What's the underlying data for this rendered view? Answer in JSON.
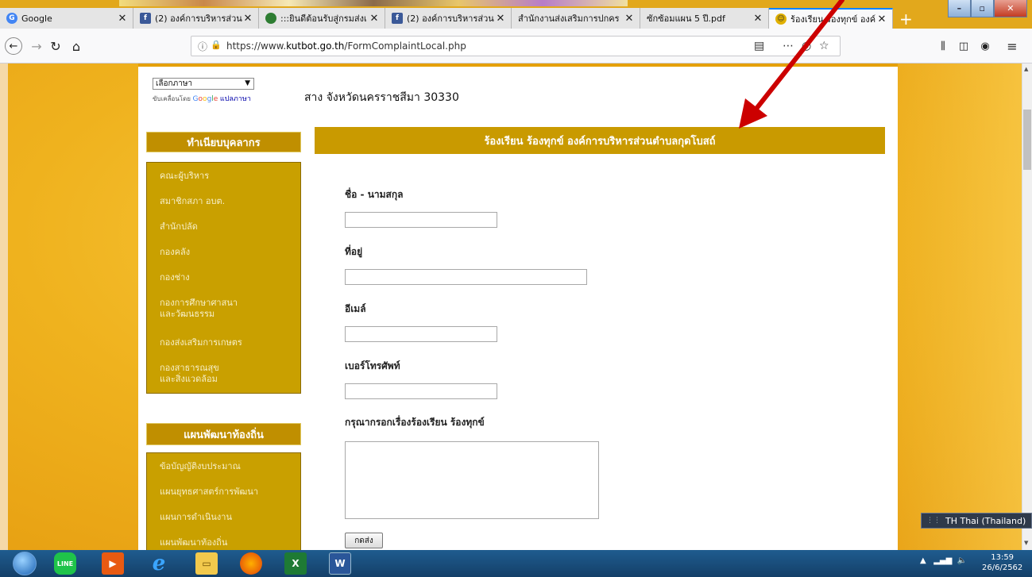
{
  "browser": {
    "tabs": [
      {
        "label": "Google",
        "icon": "google-icon",
        "color": "#4285f4",
        "glyph": "G"
      },
      {
        "label": "(2) องค์การบริหารส่วน",
        "icon": "facebook-icon",
        "color": "#3b5998",
        "glyph": "f"
      },
      {
        "label": ":::ยินดีต้อนรับสู่กรมส่งเ",
        "icon": "emblem-icon",
        "color": "#2e7d32",
        "glyph": ""
      },
      {
        "label": "(2) องค์การบริหารส่วน",
        "icon": "facebook-icon",
        "color": "#3b5998",
        "glyph": "f"
      },
      {
        "label": "สำนักงานส่งเสริมการปกคร",
        "icon": "none",
        "color": "",
        "glyph": ""
      },
      {
        "label": "ซักซ้อมแผน 5 ปี.pdf",
        "icon": "none",
        "color": "",
        "glyph": ""
      },
      {
        "label": "ร้องเรียน ร้องทุกข์ องค์",
        "icon": "smiley-icon",
        "color": "#e0b000",
        "glyph": ""
      }
    ],
    "active_tab": 6,
    "url_prefix": "https://www.",
    "url_domain": "kutbot.go.th",
    "url_path": "/FormComplaintLocal.php"
  },
  "page": {
    "language_select": "เลือกภาษา",
    "powered_by_prefix": "ขับเคลื่อนโดย",
    "powered_by_google": "Google",
    "powered_by_translate": "แปลภาษา",
    "address": "สาง จังหวัดนครราชสีมา 30330",
    "sidebar_sections": [
      {
        "title": "ทำเนียบบุคลากร",
        "items": [
          "คณะผู้บริหาร",
          "สมาชิกสภา อบต.",
          "สำนักปลัด",
          "กองคลัง",
          "กองช่าง",
          "กองการศึกษาศาสนา\nและวัฒนธรรม",
          "กองส่งเสริมการเกษตร",
          "กองสาธารณสุข\nและสิ่งแวดล้อม"
        ]
      },
      {
        "title": "แผนพัฒนาท้องถิ่น",
        "items": [
          "ข้อบัญญัติงบประมาณ",
          "แผนยุทธศาสตร์การพัฒนา",
          "แผนการดำเนินงาน",
          "แผนพัฒนาท้องถิ่น"
        ]
      }
    ],
    "form_title": "ร้องเรียน ร้องทุกข์ องค์การบริหารส่วนตำบลกุดโบสถ์",
    "fields": {
      "name_label": "ชื่อ - นามสกุล",
      "address_label": "ที่อยู่",
      "email_label": "อีเมล์",
      "phone_label": "เบอร์โทรศัพท์",
      "complaint_label": "กรุณากรอกเรื่องร้องเรียน ร้องทุกข์"
    },
    "submit_label": "กดส่ง"
  },
  "os": {
    "language_bar": "TH Thai (Thailand)",
    "clock_time": "13:59",
    "clock_date": "26/6/2562"
  },
  "colors": {
    "accent_gold": "#c99a00",
    "annotation_arrow": "#cc0000"
  }
}
